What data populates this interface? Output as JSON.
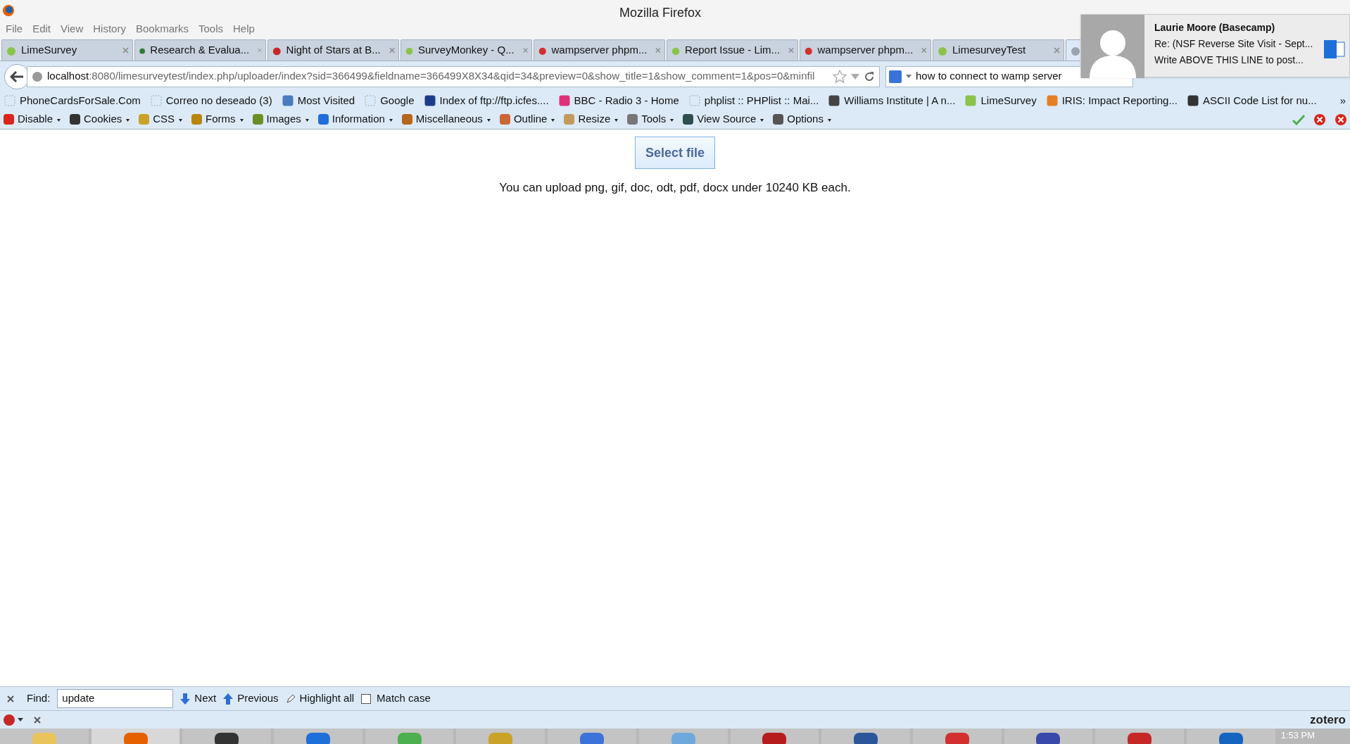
{
  "window": {
    "title": "Mozilla Firefox"
  },
  "menu": [
    "File",
    "Edit",
    "View",
    "History",
    "Bookmarks",
    "Tools",
    "Help"
  ],
  "tabs": [
    {
      "label": "LimeSurvey",
      "selected": false
    },
    {
      "label": "Research & Evalua...",
      "selected": false
    },
    {
      "label": "Night of Stars at B...",
      "selected": false
    },
    {
      "label": "SurveyMonkey - Q...",
      "selected": false
    },
    {
      "label": "wampserver phpm...",
      "selected": false
    },
    {
      "label": "Report Issue - Lim...",
      "selected": false
    },
    {
      "label": "wampserver phpm...",
      "selected": false
    },
    {
      "label": "LimesurveyTest",
      "selected": false
    },
    {
      "selected": true
    }
  ],
  "address": {
    "host": "localhost",
    "rest": ":8080/limesurveytest/index.php/uploader/index?sid=366499&fieldname=366499X8X34&qid=34&preview=0&show_title=1&show_comment=1&pos=0&minfil"
  },
  "search": {
    "value": "how to connect to wamp server"
  },
  "bookmarks": [
    "PhoneCardsForSale.Com",
    "Correo no deseado (3)",
    "Most Visited",
    "Google",
    "Index of ftp://ftp.icfes....",
    "BBC - Radio 3 - Home",
    "phplist :: PHPlist :: Mai...",
    "Williams Institute | A n...",
    "LimeSurvey",
    "IRIS: Impact Reporting...",
    "ASCII Code List for nu..."
  ],
  "bookmarks_more": "»",
  "webdev_toolbar": [
    "Disable",
    "Cookies",
    "CSS",
    "Forms",
    "Images",
    "Information",
    "Miscellaneous",
    "Outline",
    "Resize",
    "Tools",
    "View Source",
    "Options"
  ],
  "page": {
    "button": "Select file",
    "note": "You can upload png, gif, doc, odt, pdf, docx under 10240 KB each."
  },
  "find_bar": {
    "label": "Find:",
    "value": "update",
    "next": "Next",
    "previous": "Previous",
    "highlight_all": "Highlight all",
    "match_case": {
      "label": "Match case",
      "checked": false
    }
  },
  "addon_bar": {
    "brand": "zotero"
  },
  "notification": {
    "sender": "Laurie Moore (Basecamp)",
    "subject": "Re: (NSF Reverse Site Visit - Sept...",
    "preview": "Write ABOVE THIS LINE to post..."
  },
  "taskbar": {
    "clock": "1:53 PM"
  }
}
